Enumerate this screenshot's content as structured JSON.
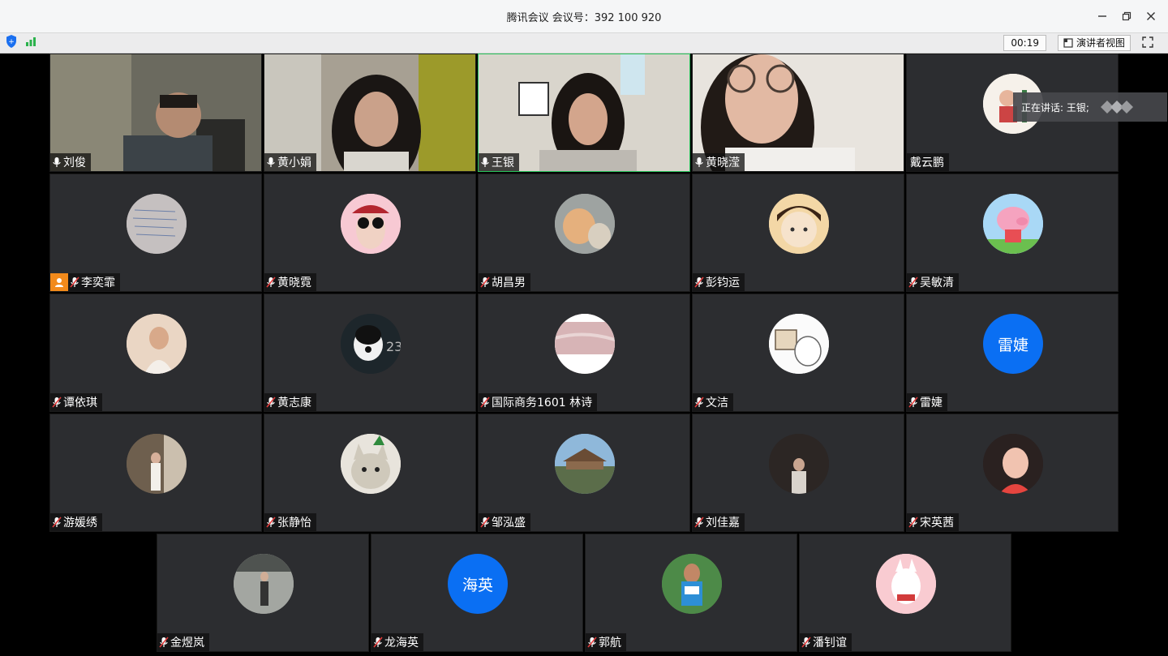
{
  "window": {
    "title": "腾讯会议 会议号：392 100 920",
    "controls": [
      "minimize",
      "restore",
      "close"
    ]
  },
  "toolbar": {
    "timer": "00:19",
    "speaker_view_label": "演讲者视图"
  },
  "speaking": {
    "label": "正在讲话: 王银;"
  },
  "participants": [
    {
      "name": "刘俊",
      "mic": "on",
      "type": "video"
    },
    {
      "name": "黄小娟",
      "mic": "on",
      "type": "video"
    },
    {
      "name": "王银",
      "mic": "on",
      "type": "video",
      "active": true
    },
    {
      "name": "黄晓滢",
      "mic": "on",
      "type": "video"
    },
    {
      "name": "戴云鹏",
      "mic": "none",
      "type": "avatar"
    },
    {
      "name": "李奕霏",
      "mic": "muted",
      "type": "avatar",
      "host": true
    },
    {
      "name": "黄晓霓",
      "mic": "muted",
      "type": "avatar"
    },
    {
      "name": "胡昌男",
      "mic": "muted",
      "type": "avatar"
    },
    {
      "name": "彭钧运",
      "mic": "muted",
      "type": "avatar"
    },
    {
      "name": "吴敏清",
      "mic": "muted",
      "type": "avatar"
    },
    {
      "name": "谭依琪",
      "mic": "muted",
      "type": "avatar"
    },
    {
      "name": "黄志康",
      "mic": "muted",
      "type": "avatar"
    },
    {
      "name": "国际商务1601 林诗",
      "mic": "muted",
      "type": "avatar"
    },
    {
      "name": "文洁",
      "mic": "muted",
      "type": "avatar"
    },
    {
      "name": "雷婕",
      "mic": "muted",
      "type": "text-avatar",
      "avatar_text": "雷婕"
    },
    {
      "name": "游媛绣",
      "mic": "muted",
      "type": "avatar"
    },
    {
      "name": "张静怡",
      "mic": "muted",
      "type": "avatar"
    },
    {
      "name": "邹泓盛",
      "mic": "muted",
      "type": "avatar"
    },
    {
      "name": "刘佳嘉",
      "mic": "muted",
      "type": "avatar"
    },
    {
      "name": "宋英茜",
      "mic": "muted",
      "type": "avatar"
    },
    {
      "name": "金煜岚",
      "mic": "muted",
      "type": "avatar"
    },
    {
      "name": "龙海英",
      "mic": "muted",
      "type": "text-avatar",
      "avatar_text": "海英"
    },
    {
      "name": "郭航",
      "mic": "muted",
      "type": "avatar"
    },
    {
      "name": "潘钊谊",
      "mic": "muted",
      "type": "avatar"
    }
  ],
  "colors": {
    "tile_bg": "#2c2d30",
    "active_border": "#27c25a",
    "text_avatar_bg": "#0a6ff3",
    "host_badge": "#f28a1b"
  }
}
